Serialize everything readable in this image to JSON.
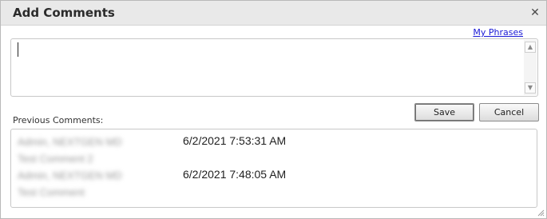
{
  "dialog": {
    "title": "Add Comments",
    "close_symbol": "✕"
  },
  "editor": {
    "my_phrases_label": "My Phrases",
    "value": "",
    "scroll_up_symbol": "▲",
    "scroll_down_symbol": "▼"
  },
  "buttons": {
    "save_label": "Save",
    "cancel_label": "Cancel"
  },
  "previous": {
    "label": "Previous Comments:",
    "entries": [
      {
        "author": "Admin, NEXTGEN MD",
        "timestamp": "6/2/2021 7:53:31 AM",
        "text": "Test Comment 2"
      },
      {
        "author": "Admin, NEXTGEN MD",
        "timestamp": "6/2/2021 7:48:05 AM",
        "text": "Test Comment"
      }
    ]
  },
  "icons": {
    "close": "close-icon",
    "scroll_up": "chevron-up-icon",
    "scroll_down": "chevron-down-icon",
    "resize": "resize-grip-icon"
  }
}
